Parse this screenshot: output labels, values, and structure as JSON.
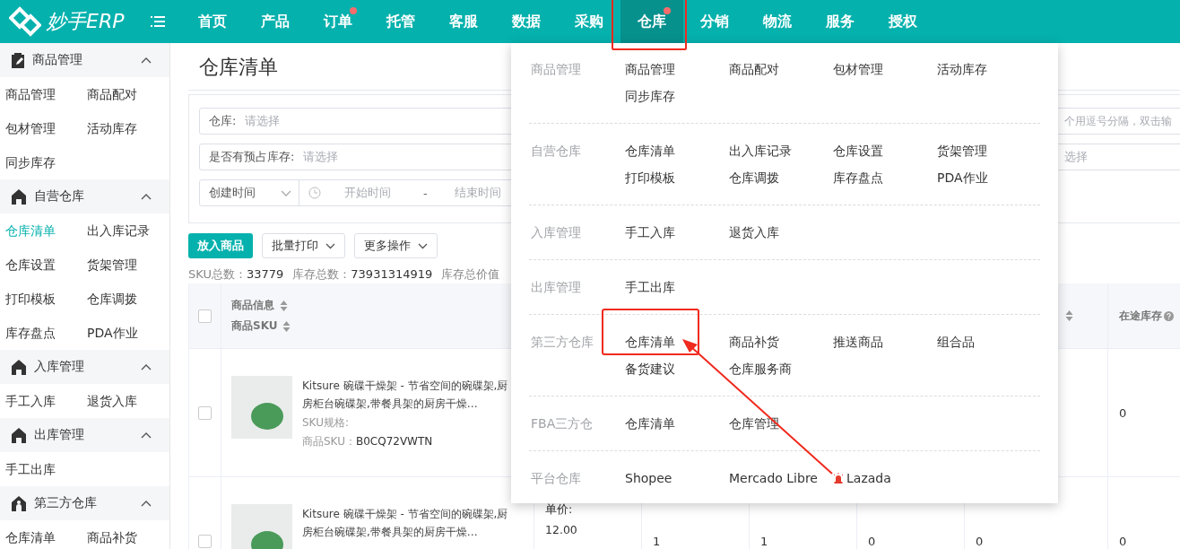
{
  "topbar": {
    "logo_text": "妙手ERP",
    "nav": [
      {
        "label": "首页",
        "selected": false,
        "dot": false
      },
      {
        "label": "产品",
        "selected": false,
        "dot": false
      },
      {
        "label": "订单",
        "selected": false,
        "dot": true
      },
      {
        "label": "托管",
        "selected": false,
        "dot": false
      },
      {
        "label": "客服",
        "selected": false,
        "dot": false
      },
      {
        "label": "数据",
        "selected": false,
        "dot": false
      },
      {
        "label": "采购",
        "selected": false,
        "dot": false
      },
      {
        "label": "仓库",
        "selected": true,
        "dot": true
      },
      {
        "label": "分销",
        "selected": false,
        "dot": false
      },
      {
        "label": "物流",
        "selected": false,
        "dot": false
      },
      {
        "label": "服务",
        "selected": false,
        "dot": false
      },
      {
        "label": "授权",
        "selected": false,
        "dot": false
      }
    ]
  },
  "sidebar": [
    {
      "title": "商品管理",
      "expanded": true,
      "items": [
        {
          "label": "商品管理",
          "selected": false
        },
        {
          "label": "商品配对",
          "selected": false
        },
        {
          "label": "包材管理",
          "selected": false
        },
        {
          "label": "活动库存",
          "selected": false
        },
        {
          "label": "同步库存",
          "selected": false
        }
      ]
    },
    {
      "title": "自营仓库",
      "expanded": true,
      "items": [
        {
          "label": "仓库清单",
          "selected": true
        },
        {
          "label": "出入库记录",
          "selected": false
        },
        {
          "label": "仓库设置",
          "selected": false
        },
        {
          "label": "货架管理",
          "selected": false
        },
        {
          "label": "打印模板",
          "selected": false
        },
        {
          "label": "仓库调拨",
          "selected": false
        },
        {
          "label": "库存盘点",
          "selected": false
        },
        {
          "label": "PDA作业",
          "selected": false
        }
      ]
    },
    {
      "title": "入库管理",
      "expanded": true,
      "items": [
        {
          "label": "手工入库",
          "selected": false
        },
        {
          "label": "退货入库",
          "selected": false
        }
      ]
    },
    {
      "title": "出库管理",
      "expanded": true,
      "items": [
        {
          "label": "手工出库",
          "selected": false
        }
      ]
    },
    {
      "title": "第三方仓库",
      "expanded": true,
      "items": [
        {
          "label": "仓库清单",
          "selected": false
        },
        {
          "label": "商品补货",
          "selected": false
        }
      ]
    }
  ],
  "page": {
    "title": "仓库清单"
  },
  "filters": {
    "warehouse": {
      "label": "仓库:",
      "placeholder": "请选择"
    },
    "sku_search": {
      "placeholder": "个用逗号分隔，双击输"
    },
    "reserved": {
      "label": "是否有预占库存:",
      "placeholder": "请选择"
    },
    "reserved_right": {
      "placeholder": "选择"
    },
    "time_type": {
      "value": "创建时间"
    },
    "start": {
      "placeholder": "开始时间"
    },
    "separator": "-",
    "end": {
      "placeholder": "结束时间"
    }
  },
  "actions": [
    {
      "label": "放入商品",
      "kind": "primary"
    },
    {
      "label": "批量打印",
      "kind": "dropdown"
    },
    {
      "label": "更多操作",
      "kind": "dropdown"
    }
  ],
  "stats": [
    {
      "label": "SKU总数：",
      "value": "33779"
    },
    {
      "label": "库存总数：",
      "value": "73931314919"
    },
    {
      "label": "库存总价值"
    }
  ],
  "table": {
    "all_checked": false,
    "sort_labels": [
      "商品信息",
      "商品SKU"
    ],
    "last_column": "在途库存",
    "rows": [
      {
        "checked": false,
        "title": "Kitsure 碗碟干燥架 - 节省空间的碗碟架,厨房柜台碗碟架,带餐具架的厨房干燥…",
        "spec_label": "SKU规格:",
        "sku_label": "商品SKU：",
        "sku": "B0CQ72VWTN",
        "prices": [],
        "values": [],
        "in_transit": "0"
      },
      {
        "checked": false,
        "title": "Kitsure 碗碟干燥架 - 节省空间的碗碟架,厨房柜台碗碟架,带餐具架的厨房干燥…",
        "prices": [
          "单价:",
          "12.00"
        ],
        "values": [
          "1",
          "1",
          "0",
          "0"
        ],
        "in_transit": "0"
      }
    ]
  },
  "menu": {
    "sections": [
      {
        "title": "商品管理",
        "items": [
          {
            "label": "商品管理"
          },
          {
            "label": "商品配对"
          },
          {
            "label": "包材管理"
          },
          {
            "label": "活动库存"
          },
          {
            "label": "同步库存"
          }
        ]
      },
      {
        "title": "自营仓库",
        "items": [
          {
            "label": "仓库清单"
          },
          {
            "label": "出入库记录"
          },
          {
            "label": "仓库设置"
          },
          {
            "label": "货架管理"
          },
          {
            "label": "打印模板"
          },
          {
            "label": "仓库调拨"
          },
          {
            "label": "库存盘点"
          },
          {
            "label": "PDA作业"
          }
        ]
      },
      {
        "title": "入库管理",
        "items": [
          {
            "label": "手工入库"
          },
          {
            "label": "退货入库"
          }
        ]
      },
      {
        "title": "出库管理",
        "items": [
          {
            "label": "手工出库"
          }
        ]
      },
      {
        "title": "第三方仓库",
        "items": [
          {
            "label": "仓库清单"
          },
          {
            "label": "商品补货"
          },
          {
            "label": "推送商品"
          },
          {
            "label": "组合品"
          },
          {
            "label": "备货建议"
          },
          {
            "label": "仓库服务商"
          }
        ]
      },
      {
        "title": "FBA三方仓",
        "items": [
          {
            "label": "仓库清单"
          },
          {
            "label": "仓库管理"
          }
        ]
      },
      {
        "title": "平台仓库",
        "items": [
          {
            "label": "Shopee",
            "kind": "plain"
          },
          {
            "label": "Mercado Libre",
            "kind": "plain"
          },
          {
            "label": "Lazada",
            "kind": "alert"
          }
        ]
      }
    ]
  }
}
